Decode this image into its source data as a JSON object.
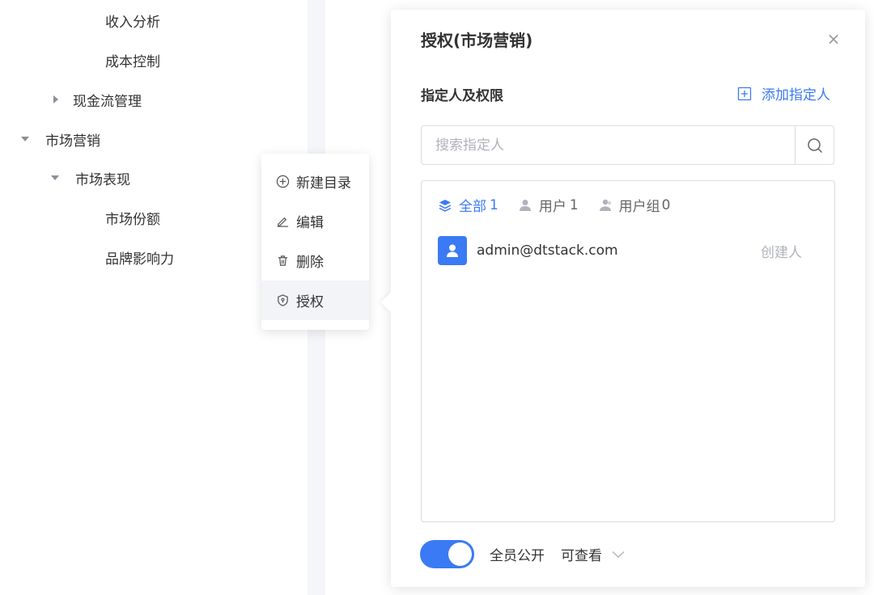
{
  "tree": {
    "items": [
      {
        "label": "收入分析"
      },
      {
        "label": "成本控制"
      },
      {
        "label": "现金流管理"
      },
      {
        "label": "市场营销"
      },
      {
        "label": "市场表现"
      },
      {
        "label": "市场份额"
      },
      {
        "label": "品牌影响力"
      }
    ]
  },
  "context_menu": {
    "items": [
      {
        "label": "新建目录",
        "icon": "plus-circle-icon"
      },
      {
        "label": "编辑",
        "icon": "pencil-icon"
      },
      {
        "label": "删除",
        "icon": "trash-icon"
      },
      {
        "label": "授权",
        "icon": "shield-icon"
      }
    ],
    "active_index": 3
  },
  "panel": {
    "title": "授权(市场营销)",
    "close_symbol": "×",
    "section_label": "指定人及权限",
    "add_person_label": "添加指定人",
    "search_placeholder": "搜索指定人",
    "filters": [
      {
        "label": "全部",
        "count": "1"
      },
      {
        "label": "用户",
        "count": "1"
      },
      {
        "label": "用户组",
        "count": "0"
      }
    ],
    "users": [
      {
        "email": "admin@dtstack.com",
        "role": "创建人"
      }
    ],
    "footer": {
      "public_label": "全员公开",
      "permission": "可查看",
      "public_enabled": true
    }
  },
  "colors": {
    "accent": "#3a7af5",
    "border": "#d9dce3",
    "muted": "#b0b3ba"
  }
}
